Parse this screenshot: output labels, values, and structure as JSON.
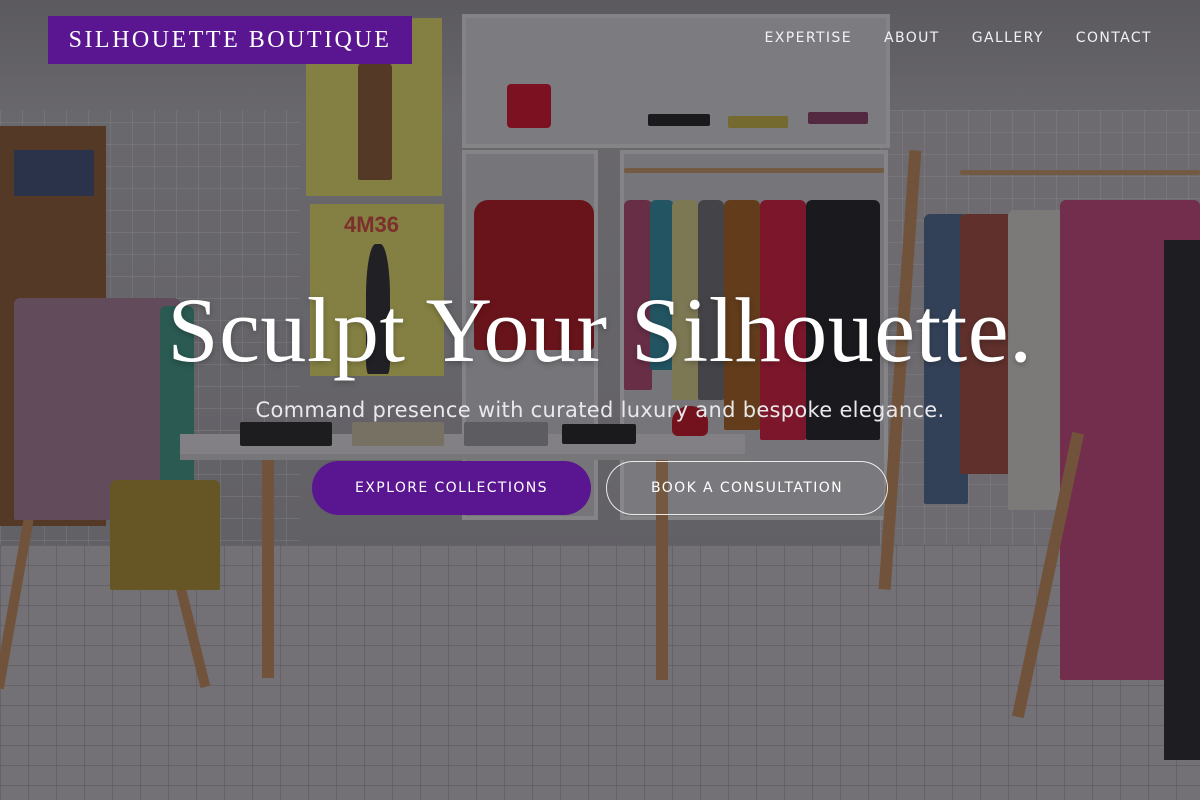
{
  "brand": {
    "name": "SILHOUETTE BOUTIQUE",
    "accent_color": "#5a1591"
  },
  "nav": {
    "items": [
      {
        "label": "EXPERTISE"
      },
      {
        "label": "ABOUT"
      },
      {
        "label": "GALLERY"
      },
      {
        "label": "CONTACT"
      }
    ]
  },
  "hero": {
    "headline": "Sculpt Your Silhouette.",
    "subheadline": "Command presence with curated luxury and bespoke elegance.",
    "primary_cta": "EXPLORE COLLECTIONS",
    "secondary_cta": "BOOK A CONSULTATION",
    "background_scene": "clothing-store-interior-photo",
    "poster_text": "4M36"
  }
}
